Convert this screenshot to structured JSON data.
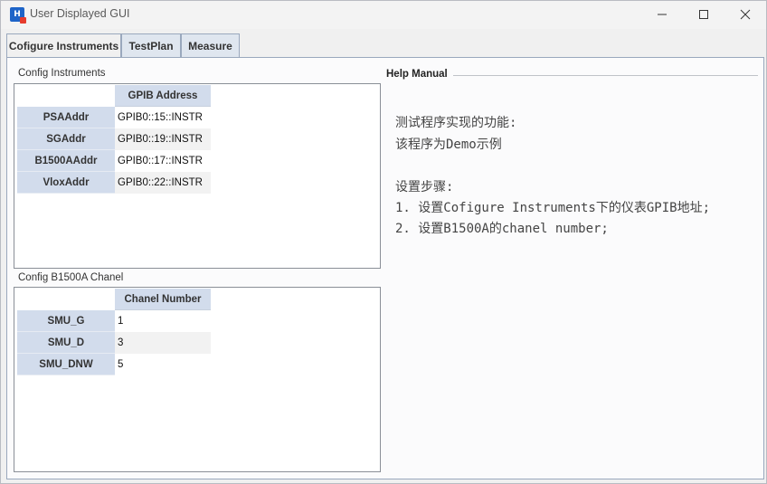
{
  "window": {
    "title": "User Displayed GUI",
    "app_icon_text": "H"
  },
  "tabs": [
    {
      "label": "Cofigure Instruments",
      "active": true
    },
    {
      "label": "TestPlan",
      "active": false
    },
    {
      "label": "Measure",
      "active": false
    }
  ],
  "config_instruments": {
    "section_label": "Config Instruments",
    "column_header": "GPIB Address",
    "rows": [
      {
        "name": "PSAAddr",
        "value": "GPIB0::15::INSTR"
      },
      {
        "name": "SGAddr",
        "value": "GPIB0::19::INSTR"
      },
      {
        "name": "B1500AAddr",
        "value": "GPIB0::17::INSTR"
      },
      {
        "name": "VloxAddr",
        "value": "GPIB0::22::INSTR"
      }
    ]
  },
  "config_chanel": {
    "section_label": "Config B1500A Chanel",
    "column_header": "Chanel Number",
    "rows": [
      {
        "name": "SMU_G",
        "value": "1"
      },
      {
        "name": "SMU_D",
        "value": "3"
      },
      {
        "name": "SMU_DNW",
        "value": "5"
      }
    ]
  },
  "help_manual": {
    "label": "Help Manual",
    "lines": [
      "测试程序实现的功能:",
      "该程序为Demo示例",
      "",
      "设置步骤:",
      "1. 设置Cofigure Instruments下的仪表GPIB地址;",
      "2. 设置B1500A的chanel number;"
    ]
  },
  "colors": {
    "header_bg": "#d2dcec",
    "tab_border": "#9aa8bd",
    "panel_border": "#8a8f97"
  }
}
